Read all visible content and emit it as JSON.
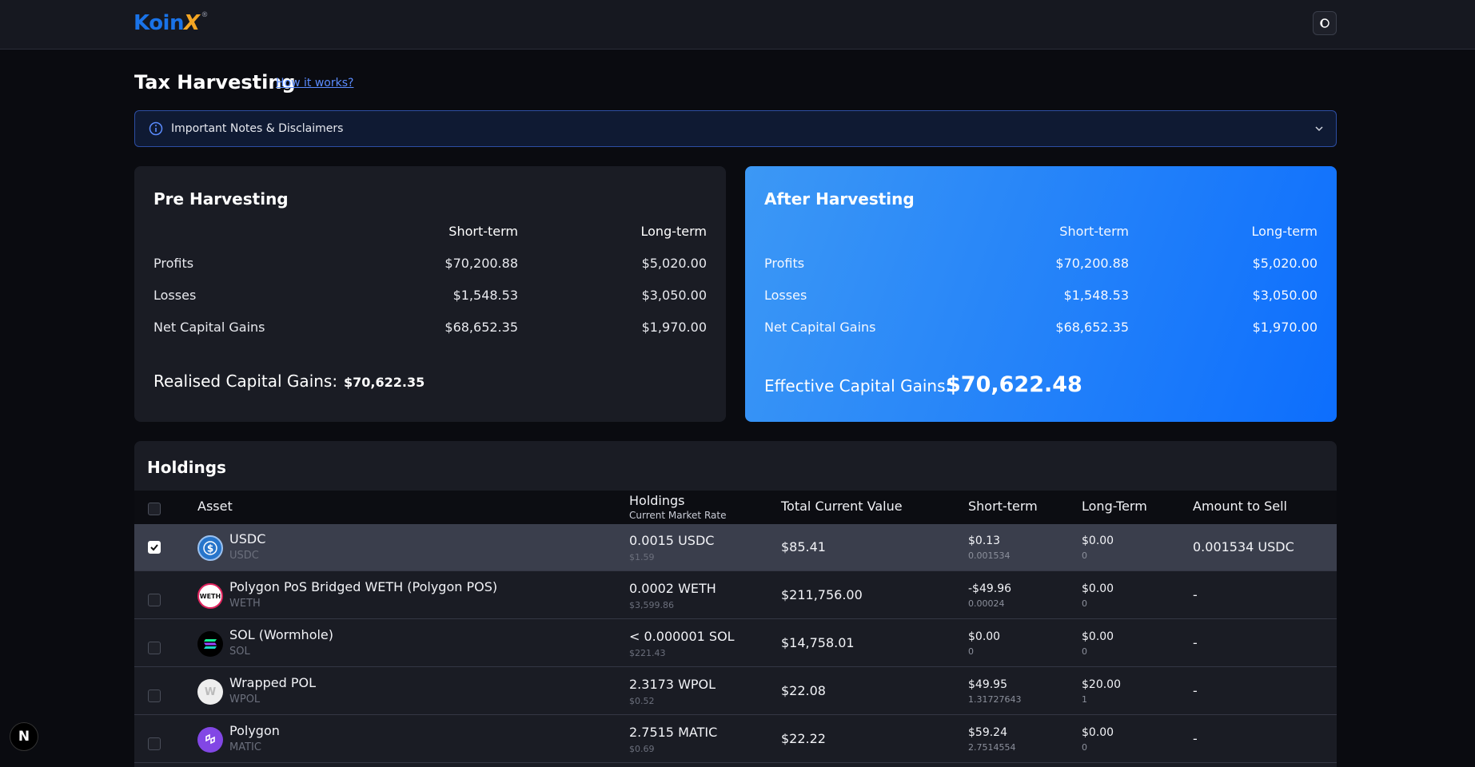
{
  "header": {
    "logo_main": "Koin",
    "logo_accent": "X",
    "logo_reg": "®"
  },
  "page": {
    "title": "Tax Harvesting",
    "how_link": "How it works?"
  },
  "notes": {
    "label": "Important Notes & Disclaimers"
  },
  "pre": {
    "title": "Pre Harvesting",
    "col_short": "Short-term",
    "col_long": "Long-term",
    "rows": [
      {
        "label": "Profits",
        "short": "$70,200.88",
        "long": "$5,020.00"
      },
      {
        "label": "Losses",
        "short": "$1,548.53",
        "long": "$3,050.00"
      },
      {
        "label": "Net Capital Gains",
        "short": "$68,652.35",
        "long": "$1,970.00"
      }
    ],
    "total_label": "Realised Capital Gains:",
    "total_value": "$70,622.35"
  },
  "after": {
    "title": "After Harvesting",
    "col_short": "Short-term",
    "col_long": "Long-term",
    "rows": [
      {
        "label": "Profits",
        "short": "$70,200.88",
        "long": "$5,020.00"
      },
      {
        "label": "Losses",
        "short": "$1,548.53",
        "long": "$3,050.00"
      },
      {
        "label": "Net Capital Gains",
        "short": "$68,652.35",
        "long": "$1,970.00"
      }
    ],
    "total_label": "Effective Capital Gains:",
    "total_value": "$70,622.48"
  },
  "holdings": {
    "title": "Holdings",
    "columns": {
      "asset": "Asset",
      "holdings": "Holdings",
      "holdings_sub": "Current Market Rate",
      "total": "Total Current Value",
      "short": "Short-term",
      "long": "Long-Term",
      "sell": "Amount to Sell"
    },
    "rows": [
      {
        "name": "USDC",
        "symbol": "USDC",
        "holding": "0.0015 USDC",
        "rate": "$1.59",
        "total": "$85.41",
        "short": "$0.13",
        "short_sub": "0.001534",
        "long": "$0.00",
        "long_sub": "0",
        "sell": "0.001534 USDC",
        "checked": true,
        "icon": "usdc-icon",
        "color": "#2775ca"
      },
      {
        "name": "Polygon PoS Bridged WETH (Polygon POS)",
        "symbol": "WETH",
        "holding": "0.0002 WETH",
        "rate": "$3,599.86",
        "total": "$211,756.00",
        "short": "-$49.96",
        "short_sub": "0.00024",
        "long": "$0.00",
        "long_sub": "0",
        "sell": "-",
        "checked": false,
        "icon": "weth-icon",
        "color": "#ffffff"
      },
      {
        "name": "SOL (Wormhole)",
        "symbol": "SOL",
        "holding": "< 0.000001 SOL",
        "rate": "$221.43",
        "total": "$14,758.01",
        "short": "$0.00",
        "short_sub": "0",
        "long": "$0.00",
        "long_sub": "0",
        "sell": "-",
        "checked": false,
        "icon": "sol-icon",
        "color": "#000000"
      },
      {
        "name": "Wrapped POL",
        "symbol": "WPOL",
        "holding": "2.3173 WPOL",
        "rate": "$0.52",
        "total": "$22.08",
        "short": "$49.95",
        "short_sub": "1.31727643",
        "long": "$20.00",
        "long_sub": "1",
        "sell": "-",
        "checked": false,
        "icon": "wpol-icon",
        "color": "#f0f0f0"
      },
      {
        "name": "Polygon",
        "symbol": "MATIC",
        "holding": "2.7515 MATIC",
        "rate": "$0.69",
        "total": "$22.22",
        "short": "$59.24",
        "short_sub": "2.7514554",
        "long": "$0.00",
        "long_sub": "0",
        "sell": "-",
        "checked": false,
        "icon": "matic-icon",
        "color": "#8247e5"
      }
    ]
  },
  "badge": {
    "letter": "N"
  }
}
